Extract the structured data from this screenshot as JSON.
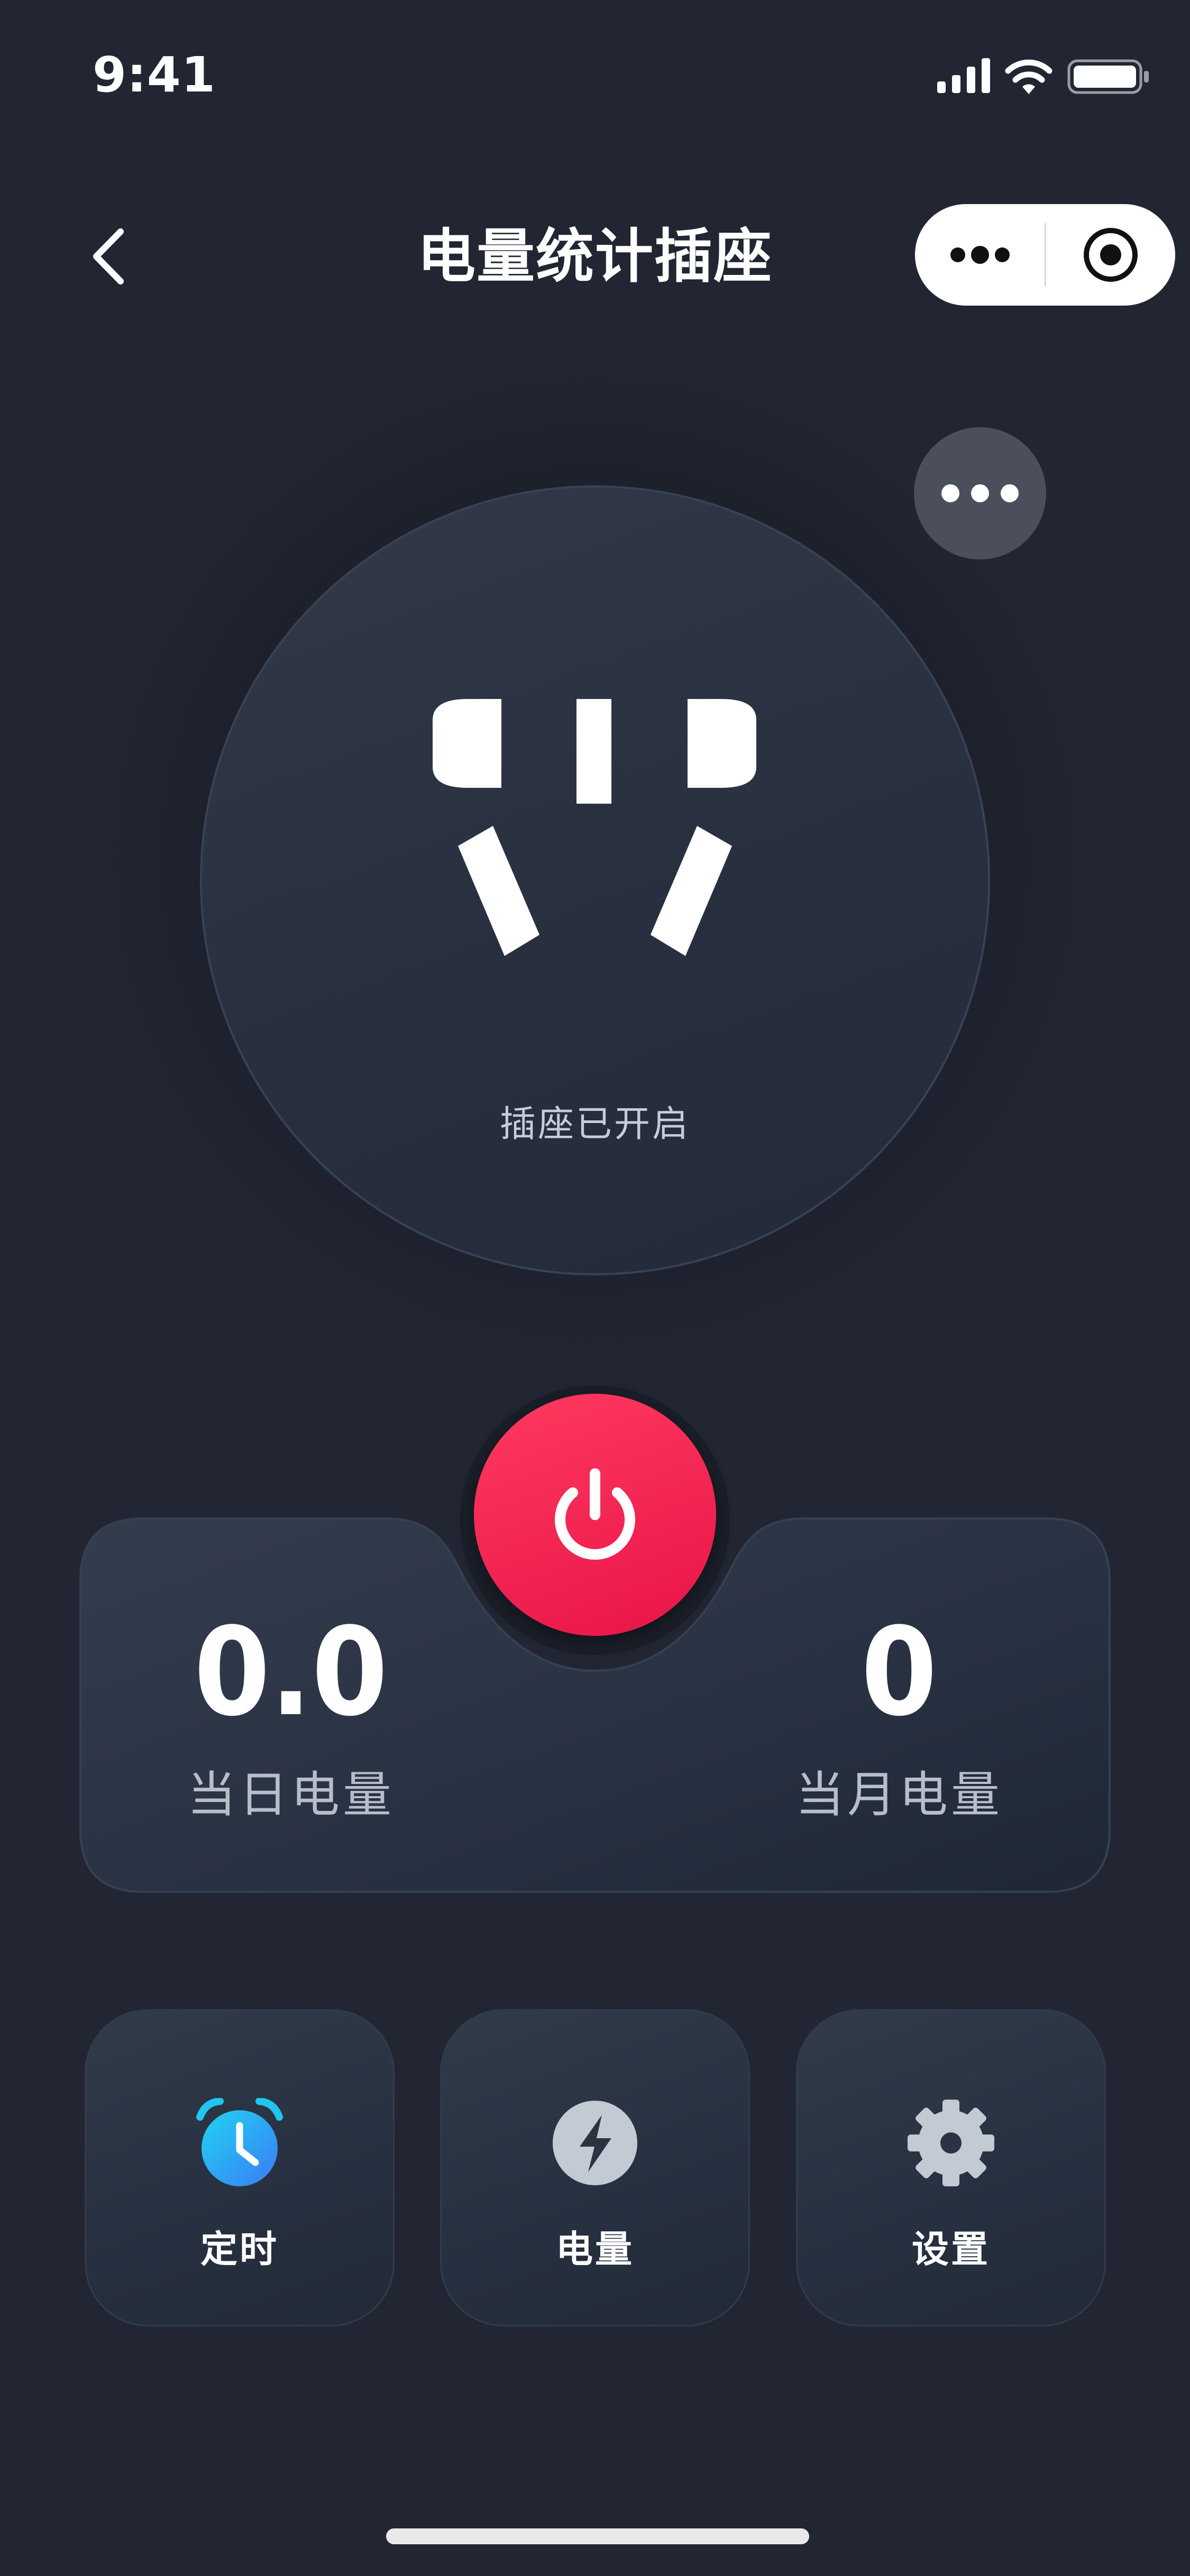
{
  "status_bar": {
    "time": "9:41"
  },
  "nav": {
    "title": "电量统计插座"
  },
  "socket": {
    "status_text": "插座已开启"
  },
  "energy": {
    "day_value": "0.0",
    "day_label": "当日电量",
    "month_value": "0",
    "month_label": "当月电量"
  },
  "tiles": [
    {
      "label": "定时",
      "icon": "alarm-clock-icon"
    },
    {
      "label": "电量",
      "icon": "lightning-icon"
    },
    {
      "label": "设置",
      "icon": "gear-icon"
    }
  ],
  "colors": {
    "background": "#222633",
    "power_button": "#f0214f",
    "timer_icon": "#1ec8f0",
    "muted_icon": "#c2cad4"
  }
}
